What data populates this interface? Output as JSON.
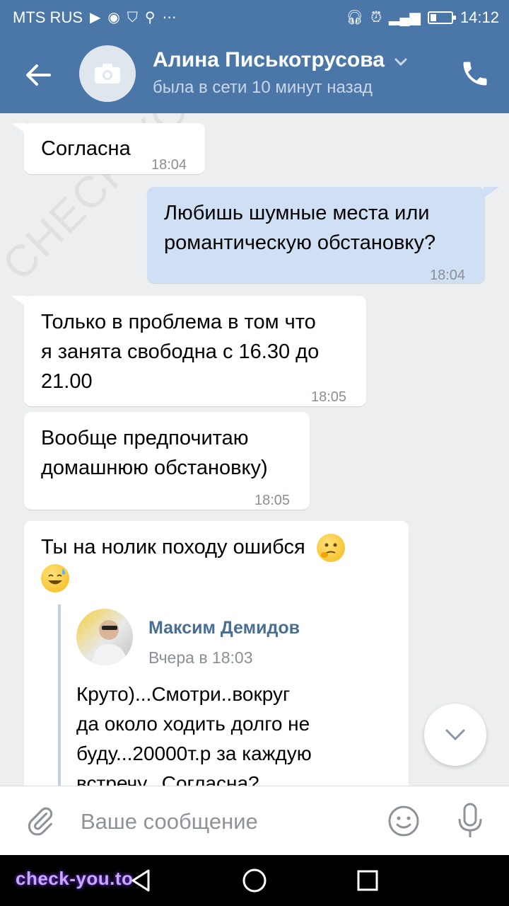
{
  "status_bar": {
    "carrier": "MTS RUS",
    "time": "14:12",
    "battery_level": 0.3
  },
  "header": {
    "contact_name": "Алина Писькотрусова",
    "contact_status": "была в сети 10 минут назад"
  },
  "messages": [
    {
      "direction": "in",
      "text": "Согласна",
      "time": "18:04"
    },
    {
      "direction": "out",
      "text": "Любишь шумные места или\nромантическую обстановку?",
      "time": "18:04"
    },
    {
      "direction": "in",
      "text": "Только в проблема в том что\nя занята свободна с 16.30 до\n21.00",
      "time": "18:05"
    },
    {
      "direction": "in",
      "text": "Вообще предпочитаю\nдомашнюю обстановку)",
      "time": "18:05"
    },
    {
      "direction": "in",
      "text": "Ты на нолик походу ошибся",
      "forwarded": {
        "author": "Максим Демидов",
        "date": "Вчера в 18:03",
        "text": "Круто)...Смотри..вокруг\nда около ходить долго не\nбуду...20000т.р за каждую\nвстречу...Согласна?"
      }
    }
  ],
  "input": {
    "placeholder": "Ваше сообщение"
  },
  "watermark": "CHECK-YOU.ME",
  "site_mark": "check-you.to",
  "colors": {
    "header": "#4a76a8",
    "chat_bg": "#edeef0",
    "outgoing_bubble": "#cfe0f5",
    "forward_author": "#4a6d94"
  }
}
